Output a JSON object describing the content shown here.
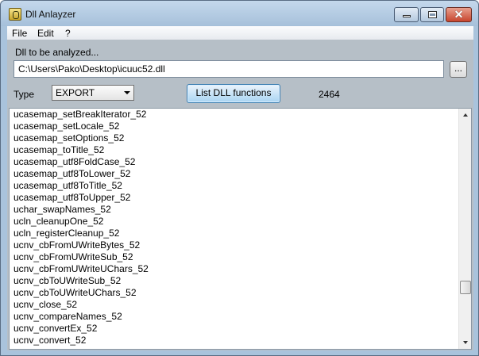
{
  "window": {
    "title": "Dll Anlayzer",
    "close_glyph": "✕"
  },
  "menu": {
    "items": [
      "File",
      "Edit",
      "?"
    ]
  },
  "form": {
    "dll_label": "Dll to be analyzed...",
    "path_value": "C:\\Users\\Pako\\Desktop\\icuuc52.dll",
    "browse_label": "...",
    "type_label": "Type",
    "type_value": "EXPORT",
    "list_button_label": "List DLL functions",
    "count": "2464"
  },
  "functions": [
    "ucasemap_setBreakIterator_52",
    "ucasemap_setLocale_52",
    "ucasemap_setOptions_52",
    "ucasemap_toTitle_52",
    "ucasemap_utf8FoldCase_52",
    "ucasemap_utf8ToLower_52",
    "ucasemap_utf8ToTitle_52",
    "ucasemap_utf8ToUpper_52",
    "uchar_swapNames_52",
    "ucln_cleanupOne_52",
    "ucln_registerCleanup_52",
    "ucnv_cbFromUWriteBytes_52",
    "ucnv_cbFromUWriteSub_52",
    "ucnv_cbFromUWriteUChars_52",
    "ucnv_cbToUWriteSub_52",
    "ucnv_cbToUWriteUChars_52",
    "ucnv_close_52",
    "ucnv_compareNames_52",
    "ucnv_convertEx_52",
    "ucnv_convert_52"
  ]
}
